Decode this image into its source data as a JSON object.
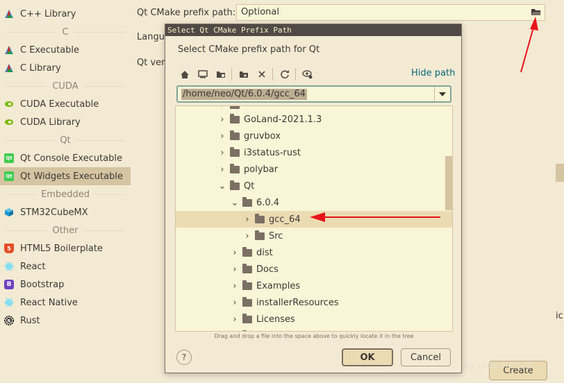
{
  "sidebar": {
    "items": [
      {
        "label": "C++ Library",
        "icon": "cmake-icon"
      },
      {
        "label": "C Executable",
        "icon": "cmake-icon"
      },
      {
        "label": "C Library",
        "icon": "cmake-icon"
      },
      {
        "label": "CUDA Executable",
        "icon": "nvidia-icon"
      },
      {
        "label": "CUDA Library",
        "icon": "nvidia-icon"
      },
      {
        "label": "Qt Console Executable",
        "icon": "qt-icon"
      },
      {
        "label": "Qt Widgets Executable",
        "icon": "qt-icon",
        "selected": true
      },
      {
        "label": "STM32CubeMX",
        "icon": "cube-icon"
      },
      {
        "label": "HTML5 Boilerplate",
        "icon": "html5-icon"
      },
      {
        "label": "React",
        "icon": "react-icon"
      },
      {
        "label": "Bootstrap",
        "icon": "bootstrap-icon"
      },
      {
        "label": "React Native",
        "icon": "react-icon"
      },
      {
        "label": "Rust",
        "icon": "rust-icon"
      }
    ],
    "headers": [
      "C",
      "CUDA",
      "Qt",
      "Embedded",
      "Other"
    ]
  },
  "form": {
    "prefix_label": "Qt CMake prefix path:",
    "prefix_placeholder": "Optional",
    "language_label": "Langua",
    "version_label": "Qt vers"
  },
  "dialog": {
    "title": "Select Qt CMake Prefix Path",
    "description": "Select CMake prefix path for Qt",
    "hide_path": "Hide path",
    "path": "/home/neo/Qt/6.0.4/gcc_64",
    "tree": [
      {
        "label": "GoLand-2021.1.3",
        "expanded": false
      },
      {
        "label": "gruvbox",
        "expanded": false
      },
      {
        "label": "i3status-rust",
        "expanded": false
      },
      {
        "label": "polybar",
        "expanded": false
      },
      {
        "label": "Qt",
        "expanded": true
      },
      {
        "label": "6.0.4",
        "expanded": true
      },
      {
        "label": "gcc_64",
        "expanded": false,
        "selected": true
      },
      {
        "label": "Src",
        "expanded": false
      },
      {
        "label": "dist",
        "expanded": false
      },
      {
        "label": "Docs",
        "expanded": false
      },
      {
        "label": "Examples",
        "expanded": false
      },
      {
        "label": "installerResources",
        "expanded": false
      },
      {
        "label": "Licenses",
        "expanded": false
      }
    ],
    "hint": "Drag and drop a file into the space above to quickly locate it in the tree",
    "help": "?",
    "ok": "OK",
    "cancel": "Cancel"
  },
  "create": "Create",
  "watermark": "https://blog.csdn.net/u0",
  "right_edge_text": "ic",
  "colors": {
    "accent": "#076678",
    "selection": "#d5c4a1",
    "annotation": "#e8141a"
  }
}
